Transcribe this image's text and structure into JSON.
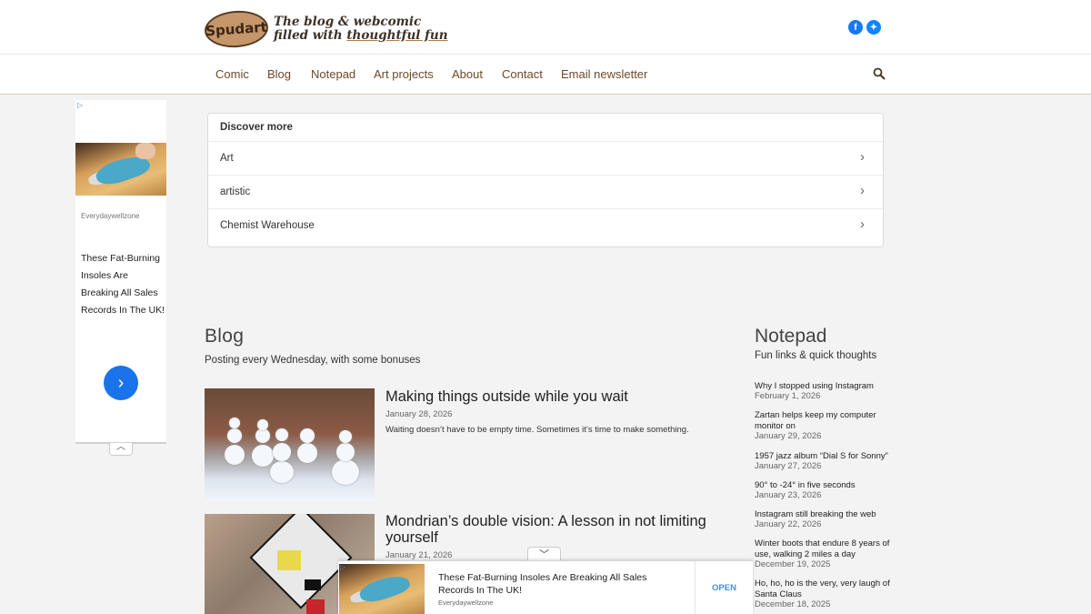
{
  "header": {
    "logo_text": "Spudart",
    "tagline_line1": "The blog & webcomic",
    "tagline_line2_a": "filled with ",
    "tagline_line2_b": "thoughtful fun",
    "social": [
      {
        "name": "facebook",
        "glyph": "f"
      },
      {
        "name": "bluesky",
        "glyph": "✦"
      }
    ]
  },
  "nav": {
    "items": [
      "Comic",
      "Blog",
      "Notepad",
      "Art projects",
      "About",
      "Contact",
      "Email newsletter"
    ]
  },
  "side_ad": {
    "ad_choice": "▷",
    "source": "Everydaywellzone",
    "headline": "These Fat-Burning Insoles Are Breaking All Sales Records In The UK!",
    "arrow": "›",
    "collapse": "︿"
  },
  "discover": {
    "title": "Discover more",
    "items": [
      "Art",
      "artistic",
      "Chemist Warehouse"
    ],
    "chevron": "›"
  },
  "blog": {
    "title": "Blog",
    "subtitle": "Posting every Wednesday, with some bonuses",
    "posts": [
      {
        "title": "Making things outside while you wait",
        "date": "January 28, 2026",
        "excerpt": "Waiting doesn’t have to be empty time. Sometimes it’s time to make something."
      },
      {
        "title": "Mondrian’s double vision: A lesson in not limiting yourself",
        "date": "January 21, 2026"
      }
    ]
  },
  "notepad": {
    "title": "Notepad",
    "subtitle": "Fun links & quick thoughts",
    "items": [
      {
        "title": "Why I stopped using Instagram",
        "date": "February 1, 2026"
      },
      {
        "title": "Zartan helps keep my computer monitor on",
        "date": "January 29, 2026"
      },
      {
        "title": "1957 jazz album “Dial S for Sonny”",
        "date": "January 27, 2026"
      },
      {
        "title": "90° to -24° in five seconds",
        "date": "January 23, 2026"
      },
      {
        "title": "Instagram still breaking the web",
        "date": "January 22, 2026"
      },
      {
        "title": "Winter boots that endure 8 years of use, walking 2 miles a day",
        "date": "December 19, 2025"
      },
      {
        "title": "Ho, ho, ho is the very, very laugh of Santa Claus",
        "date": "December 18, 2025"
      }
    ]
  },
  "bottom_ad": {
    "ad_choice": "▷",
    "headline": "These Fat-Burning Insoles Are Breaking All Sales Records In The UK!",
    "source": "Everydaywellzone",
    "cta": "OPEN",
    "collapse": "﹀"
  },
  "colors": {
    "nav_text": "#6b4a2a",
    "accent_blue": "#1a73e8",
    "page_bg": "#f3f3f3"
  }
}
